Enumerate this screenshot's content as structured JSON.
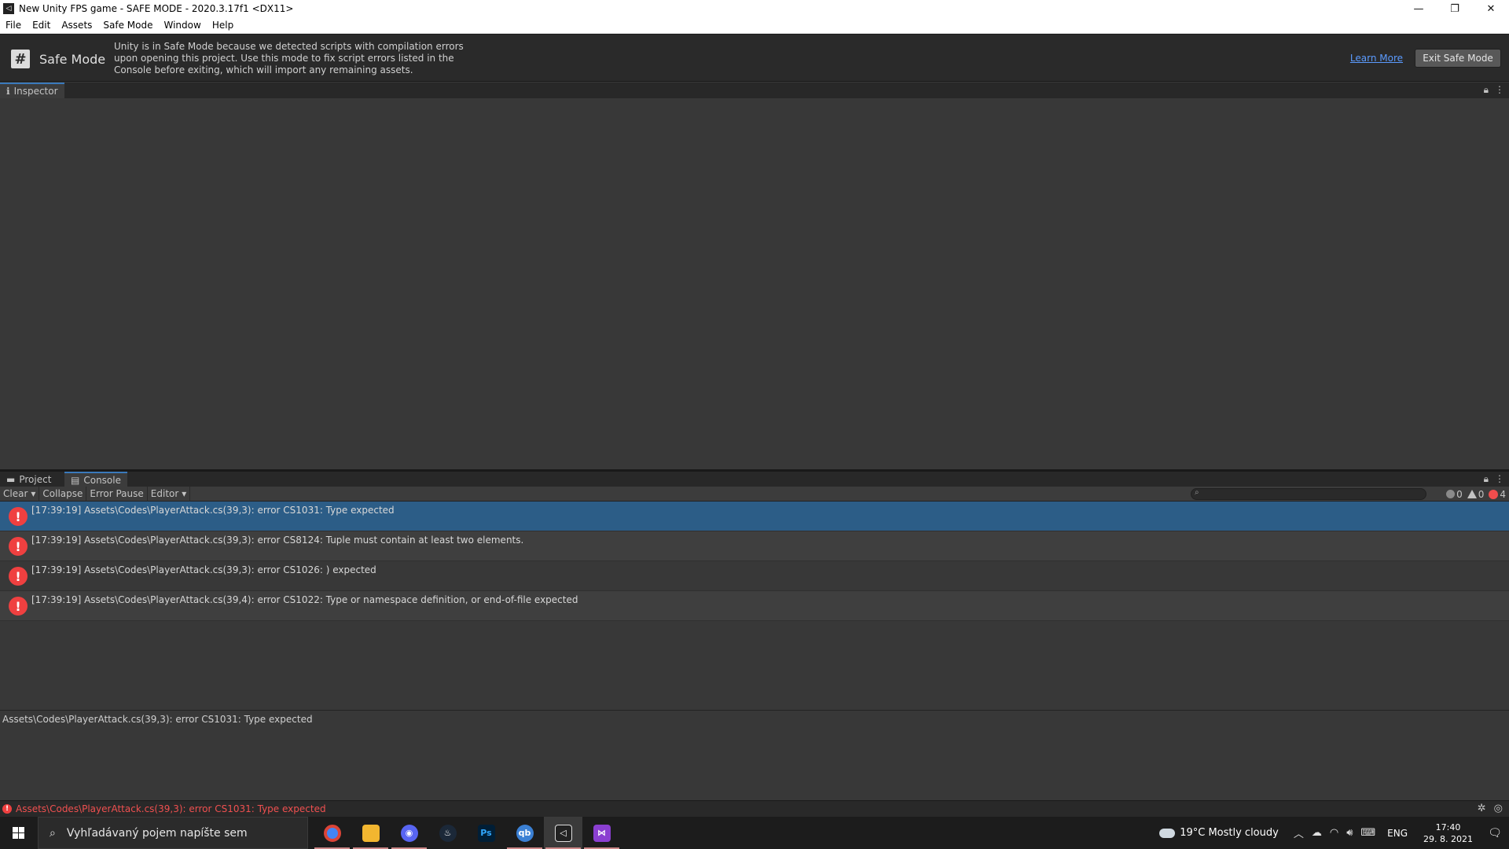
{
  "window": {
    "title": "New Unity FPS game - SAFE MODE - 2020.3.17f1 <DX11>",
    "minimize": "—",
    "restore": "❐",
    "close": "✕"
  },
  "menu": {
    "items": [
      "File",
      "Edit",
      "Assets",
      "Safe Mode",
      "Window",
      "Help"
    ]
  },
  "safe_mode": {
    "icon_glyph": "#",
    "title": "Safe Mode",
    "message": "Unity is in Safe Mode because we detected scripts with compilation errors upon opening this project. Use this mode to fix script errors listed in the Console before exiting, which will import any remaining assets.",
    "learn_more": "Learn More",
    "exit_button": "Exit Safe Mode"
  },
  "inspector": {
    "tab_label": "Inspector"
  },
  "console": {
    "tabs": [
      "Project",
      "Console"
    ],
    "toolbar": {
      "clear": "Clear",
      "collapse": "Collapse",
      "error_pause": "Error Pause",
      "editor": "Editor"
    },
    "counts": {
      "info": "0",
      "warnings": "0",
      "errors": "4"
    },
    "entries": [
      "[17:39:19] Assets\\Codes\\PlayerAttack.cs(39,3): error CS1031: Type expected",
      "[17:39:19] Assets\\Codes\\PlayerAttack.cs(39,3): error CS8124: Tuple must contain at least two elements.",
      "[17:39:19] Assets\\Codes\\PlayerAttack.cs(39,3): error CS1026: ) expected",
      "[17:39:19] Assets\\Codes\\PlayerAttack.cs(39,4): error CS1022: Type or namespace definition, or end-of-file expected"
    ],
    "selected_detail": "Assets\\Codes\\PlayerAttack.cs(39,3): error CS1031: Type expected"
  },
  "status_bar": {
    "message": "Assets\\Codes\\PlayerAttack.cs(39,3): error CS1031: Type expected"
  },
  "taskbar": {
    "search_placeholder": "Vyhľadávaný pojem napíšte sem",
    "apps": [
      {
        "name": "Chrome",
        "glyph": "",
        "color": "#4285f4"
      },
      {
        "name": "File Explorer",
        "glyph": "",
        "color": "#f2b630"
      },
      {
        "name": "Discord",
        "glyph": "◉",
        "color": "#5865f2"
      },
      {
        "name": "Steam",
        "glyph": "♨",
        "color": "#1b2838"
      },
      {
        "name": "Photoshop",
        "glyph": "Ps",
        "color": "#001e36"
      },
      {
        "name": "qBittorrent",
        "glyph": "qb",
        "color": "#3b80d4"
      },
      {
        "name": "Unity",
        "glyph": "◁",
        "color": "#222222"
      },
      {
        "name": "Visual Studio",
        "glyph": "⋈",
        "color": "#8b3fd1"
      }
    ],
    "weather": "19°C  Mostly cloudy",
    "language": "ENG",
    "time": "17:40",
    "date": "29. 8. 2021"
  }
}
